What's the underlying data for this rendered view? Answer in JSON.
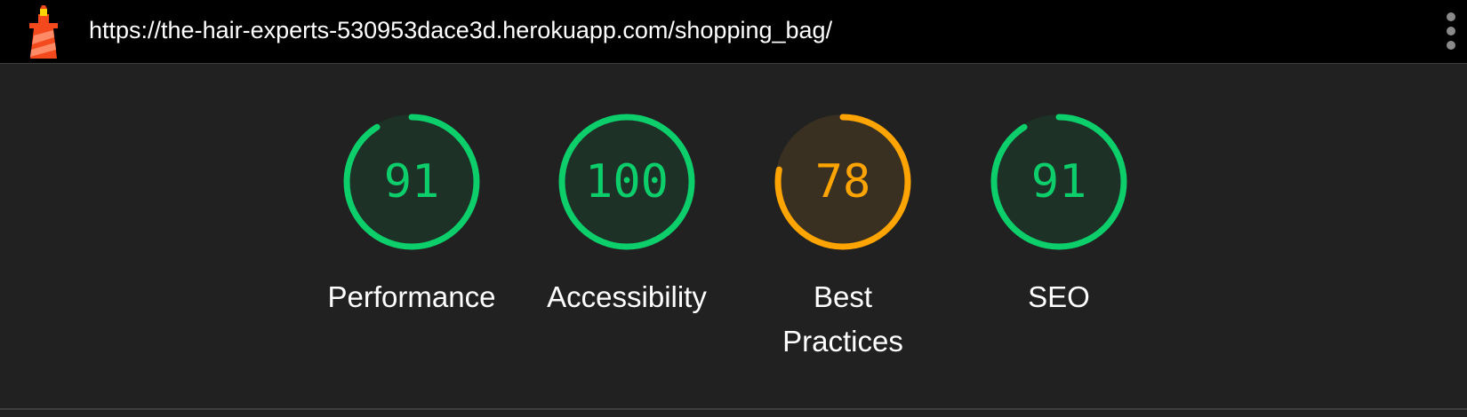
{
  "header": {
    "url": "https://the-hair-experts-530953dace3d.herokuapp.com/shopping_bag/",
    "logo_icon": "lighthouse-icon",
    "menu_icon": "more-vertical-icon"
  },
  "colors": {
    "pass": "#0cce6b",
    "pass_bg": "#1d3126",
    "average": "#ffa400",
    "average_bg": "#3a3022"
  },
  "scores": [
    {
      "label": "Performance",
      "score": "91",
      "value": 91,
      "rating": "pass"
    },
    {
      "label": "Accessibility",
      "score": "100",
      "value": 100,
      "rating": "pass"
    },
    {
      "label": "Best Practices",
      "score": "78",
      "value": 78,
      "rating": "average"
    },
    {
      "label": "SEO",
      "score": "91",
      "value": 91,
      "rating": "pass"
    }
  ]
}
